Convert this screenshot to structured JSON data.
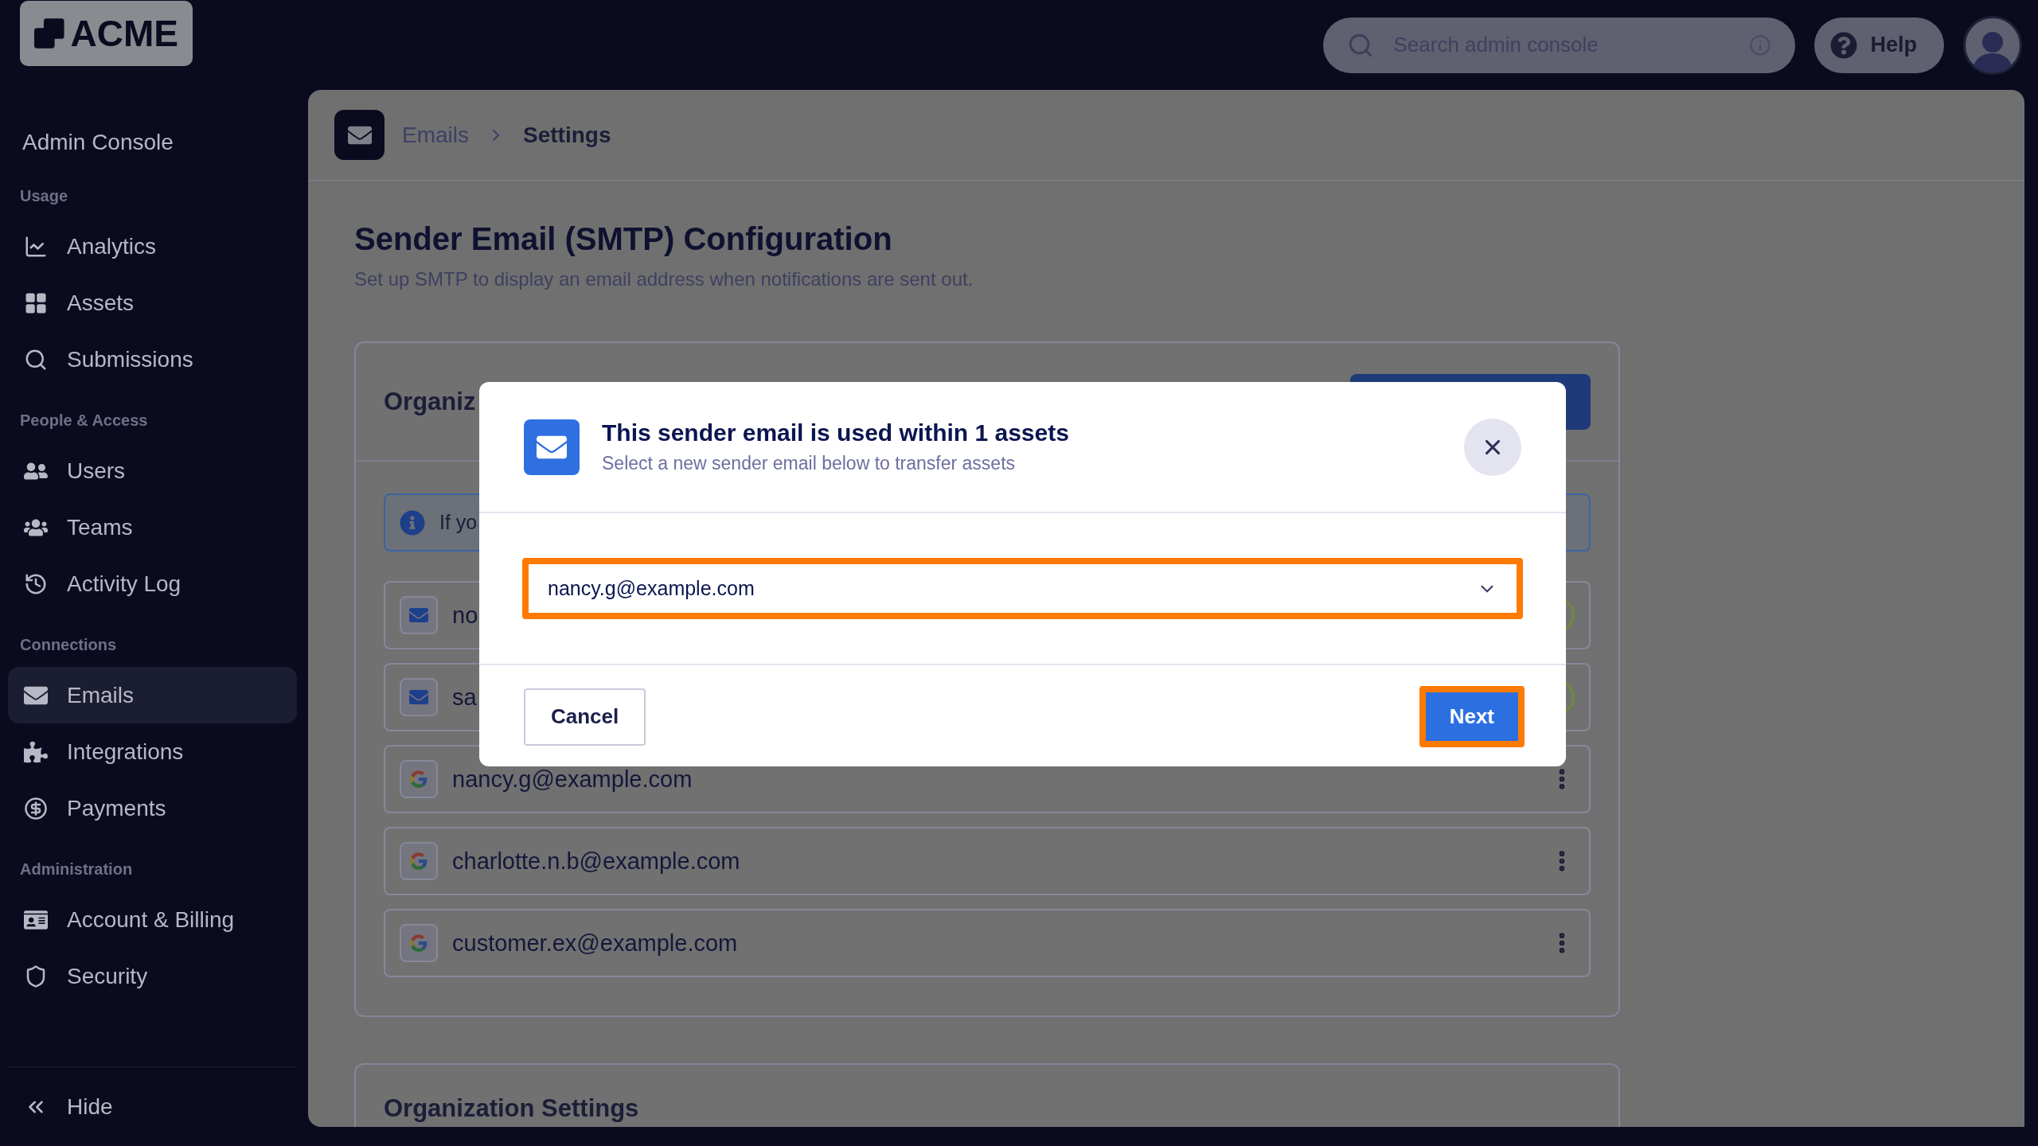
{
  "logo": {
    "text": "ACME"
  },
  "search": {
    "placeholder": "Search admin console"
  },
  "help": {
    "label": "Help"
  },
  "sidebar": {
    "title": "Admin Console",
    "sections": [
      {
        "heading": "Usage",
        "items": [
          {
            "label": "Analytics",
            "selected": false
          },
          {
            "label": "Assets",
            "selected": false
          },
          {
            "label": "Submissions",
            "selected": false
          }
        ]
      },
      {
        "heading": "People & Access",
        "items": [
          {
            "label": "Users",
            "selected": false
          },
          {
            "label": "Teams",
            "selected": false
          },
          {
            "label": "Activity Log",
            "selected": false
          }
        ]
      },
      {
        "heading": "Connections",
        "items": [
          {
            "label": "Emails",
            "selected": true
          },
          {
            "label": "Integrations",
            "selected": false
          },
          {
            "label": "Payments",
            "selected": false
          }
        ]
      },
      {
        "heading": "Administration",
        "items": [
          {
            "label": "Account & Billing",
            "selected": false
          },
          {
            "label": "Security",
            "selected": false
          }
        ]
      }
    ],
    "collapse": {
      "label": "Hide"
    }
  },
  "breadcrumb": [
    "Emails",
    "Settings"
  ],
  "page": {
    "title": "Sender Email (SMTP) Configuration",
    "subtitle": "Set up SMTP to display an email address when notifications are sent out."
  },
  "email_card": {
    "heading": "Organiz",
    "info": "If yo",
    "senders": [
      {
        "address": "no",
        "kind": "smtp"
      },
      {
        "address": "sa",
        "kind": "smtp"
      },
      {
        "address": "nancy.g@example.com",
        "kind": "google"
      },
      {
        "address": "charlotte.n.b@example.com",
        "kind": "google"
      },
      {
        "address": "customer.ex@example.com",
        "kind": "google"
      }
    ]
  },
  "settings_card": {
    "heading": "Organization Settings"
  },
  "modal": {
    "title": "This sender email is used within 1 assets",
    "subtitle": "Select a new sender email below to transfer assets",
    "select": {
      "value": "nancy.g@example.com",
      "highlighted": true
    },
    "buttons": [
      {
        "label": "Cancel",
        "kind": "secondary",
        "highlighted": false
      },
      {
        "label": "Next",
        "kind": "primary",
        "highlighted": true
      }
    ]
  }
}
